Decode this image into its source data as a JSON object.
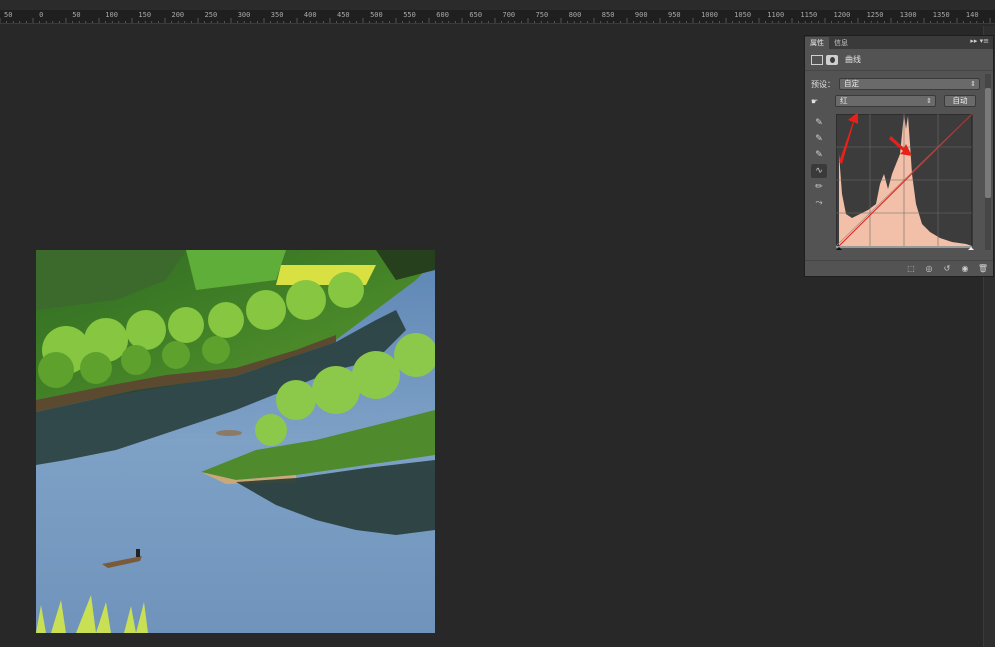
{
  "ruler": {
    "labels": [
      "50",
      "0",
      "50",
      "100",
      "150",
      "200",
      "250",
      "300",
      "350",
      "400",
      "450",
      "500",
      "550",
      "600",
      "650",
      "700",
      "750",
      "800",
      "850",
      "900",
      "950",
      "1000",
      "1050",
      "1100",
      "1150",
      "1200",
      "1250",
      "1300",
      "1350",
      "140"
    ]
  },
  "properties_panel": {
    "tabs": [
      "属性",
      "信息"
    ],
    "menu_glyph": "▸▸ ▾≡",
    "title": "曲线",
    "preset_label": "预设：",
    "preset_value": "自定",
    "channel_value": "红",
    "auto_button": "自动",
    "tools": [
      "hand-adjust-icon",
      "black-eyedropper-icon",
      "gray-eyedropper-icon",
      "white-eyedropper-icon",
      "curve-point-icon",
      "pencil-icon",
      "smooth-icon"
    ],
    "curve_color": "#e0201a",
    "histogram_fill": "#f2c0a8",
    "annotation_color": "#e8201a"
  }
}
